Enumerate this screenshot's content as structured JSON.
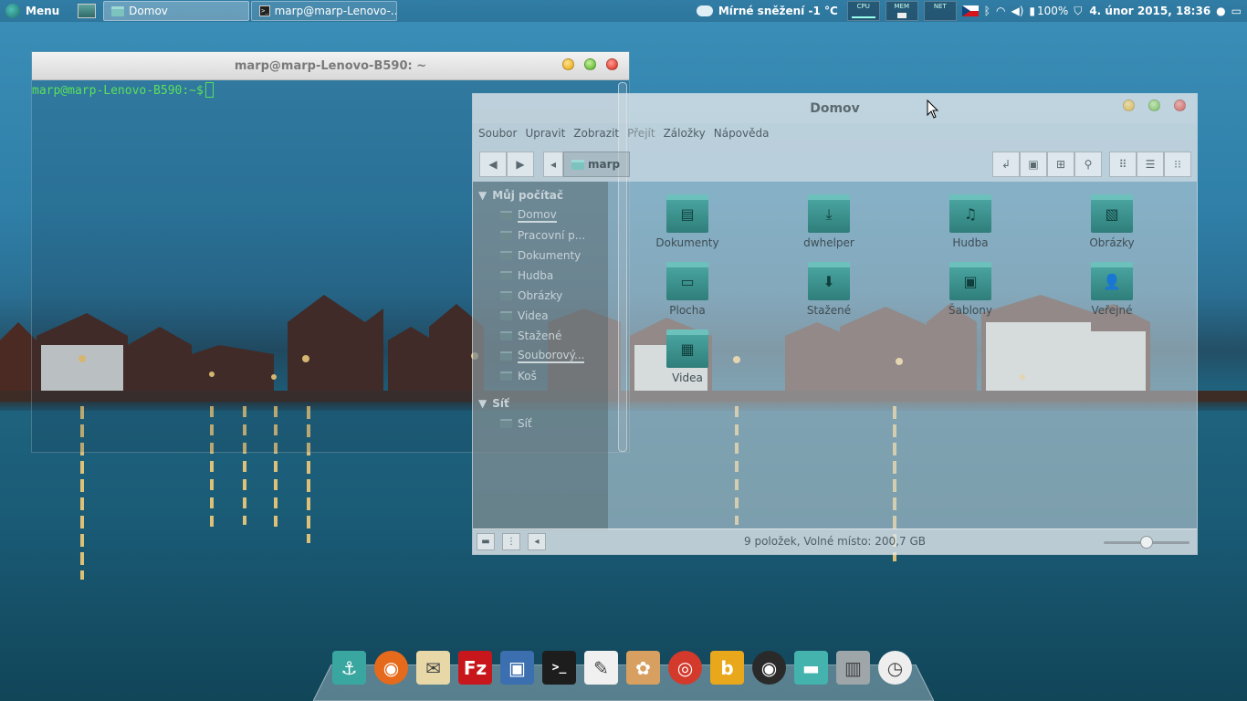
{
  "top_panel": {
    "menu_label": "Menu",
    "tasks": [
      {
        "label": "Domov",
        "icon": "folder-icon",
        "active": true
      },
      {
        "label": "marp@marp-Lenovo-...",
        "icon": "terminal-icon",
        "active": false
      }
    ],
    "weather": "Mírné sněžení -1 °C",
    "monitors": [
      "CPU",
      "MEM",
      "NET"
    ],
    "battery": "100%",
    "datetime": "4. únor 2015, 18:36"
  },
  "terminal": {
    "title": "marp@marp-Lenovo-B590: ~",
    "prompt": "marp@marp-Lenovo-B590:~$"
  },
  "file_manager": {
    "title": "Domov",
    "menu": [
      "Soubor",
      "Upravit",
      "Zobrazit",
      "Přejít",
      "Záložky",
      "Nápověda"
    ],
    "path": "marp",
    "sidebar": {
      "section_computer": "Můj počítač",
      "items": [
        "Domov",
        "Pracovní p...",
        "Dokumenty",
        "Hudba",
        "Obrázky",
        "Videa",
        "Stažené",
        "Souborový...",
        "Koš"
      ],
      "section_network": "Síť",
      "network_items": [
        "Síť"
      ]
    },
    "files": [
      {
        "label": "Dokumenty",
        "icon": "document-folder-icon"
      },
      {
        "label": "dwhelper",
        "icon": "download-folder-icon"
      },
      {
        "label": "Hudba",
        "icon": "music-folder-icon"
      },
      {
        "label": "Obrázky",
        "icon": "pictures-folder-icon"
      },
      {
        "label": "Plocha",
        "icon": "desktop-folder-icon"
      },
      {
        "label": "Stažené",
        "icon": "downloads-folder-icon"
      },
      {
        "label": "Šablony",
        "icon": "templates-folder-icon"
      },
      {
        "label": "Veřejné",
        "icon": "public-folder-icon"
      },
      {
        "label": "Videa",
        "icon": "video-folder-icon"
      }
    ],
    "status": "9 položek, Volné místo: 200,7 GB",
    "zoom_level": 0.5
  },
  "dock": [
    {
      "name": "anchor-icon",
      "color": "#3aa6a0"
    },
    {
      "name": "firefox-icon",
      "color": "#e66a1c"
    },
    {
      "name": "mail-stamp-icon",
      "color": "#e8d8a8"
    },
    {
      "name": "filezilla-icon",
      "color": "#c8171c"
    },
    {
      "name": "save-disk-icon",
      "color": "#3c6fb0"
    },
    {
      "name": "terminal-icon",
      "color": "#1d1d1d"
    },
    {
      "name": "text-editor-icon",
      "color": "#f0f0f0"
    },
    {
      "name": "paint-palette-icon",
      "color": "#d8a060"
    },
    {
      "name": "music-player-icon",
      "color": "#d33a2c"
    },
    {
      "name": "bittorrent-icon",
      "color": "#e9a81c"
    },
    {
      "name": "camera-icon",
      "color": "#2a2a2a"
    },
    {
      "name": "files-icon",
      "color": "#45b3ad"
    },
    {
      "name": "trash-icon",
      "color": "#9ea6aa"
    },
    {
      "name": "clock-icon",
      "color": "#eeeeee"
    }
  ]
}
